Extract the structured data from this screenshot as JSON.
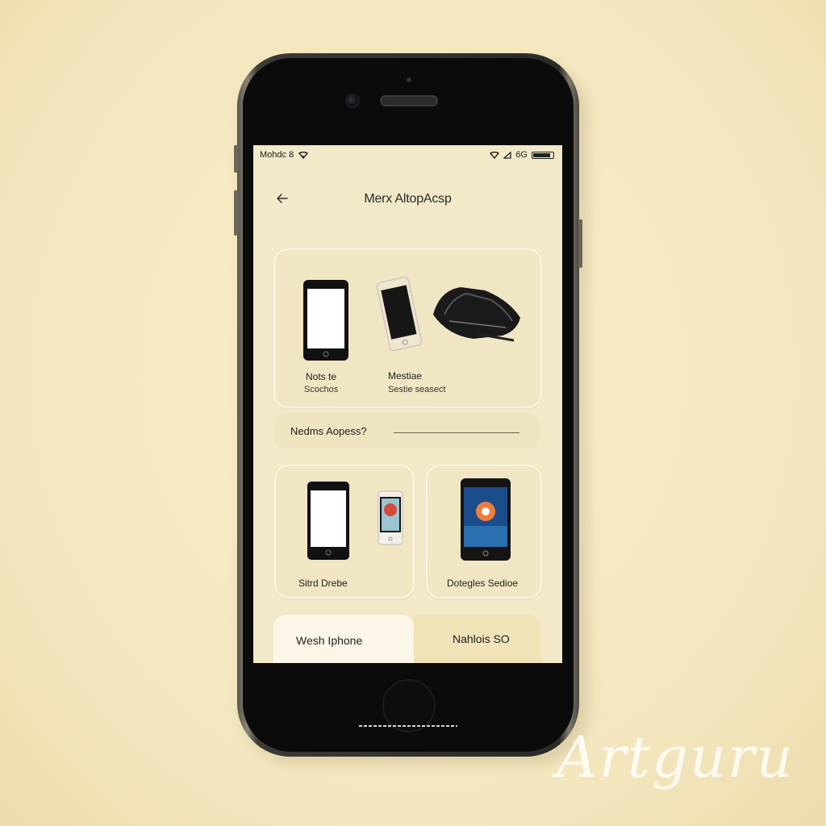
{
  "status_bar": {
    "left_text": "Mohdc 8",
    "right_text": "6G"
  },
  "header": {
    "title": "Merx AltopAcsp"
  },
  "feature_card": {
    "item_1": {
      "line1": "Nots te",
      "line2": "Scochos"
    },
    "item_2": {
      "line1": "Mestiae",
      "line2": "Sestie seasect"
    }
  },
  "search": {
    "label": "Nedms Aopess?"
  },
  "cards": [
    {
      "label": "Sitrd Drebe"
    },
    {
      "label": "Dotegles Sedioe"
    }
  ],
  "bottom_tabs": [
    {
      "label": "Wesh Iphone"
    },
    {
      "label": "Nahlois SO"
    }
  ],
  "watermark": "Artguru",
  "colors": {
    "background": "#f6ebc3",
    "screen": "#f2e9c9",
    "card": "#f1e6c3",
    "phone_body": "#0b0b0b"
  }
}
